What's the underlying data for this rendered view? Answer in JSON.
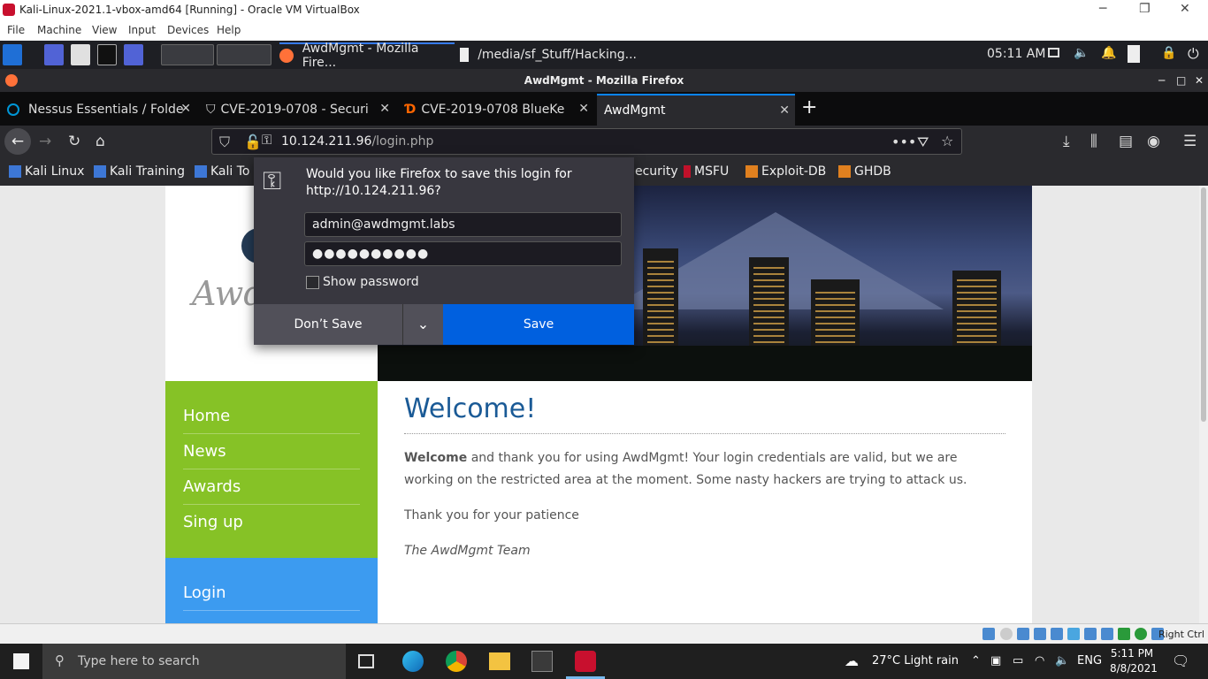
{
  "vbox": {
    "title": "Kali-Linux-2021.1-vbox-amd64 [Running] - Oracle VM VirtualBox",
    "menu": [
      "File",
      "Machine",
      "View",
      "Input",
      "Devices",
      "Help"
    ],
    "status_right": "Right Ctrl"
  },
  "kali_panel": {
    "tasks": [
      {
        "label": "AwdMgmt - Mozilla Fire..."
      },
      {
        "label": "/media/sf_Stuff/Hacking..."
      }
    ],
    "clock": "05:11 AM"
  },
  "firefox": {
    "window_title": "AwdMgmt - Mozilla Firefox",
    "tabs": [
      {
        "label": "Nessus Essentials / Folde"
      },
      {
        "label": "CVE-2019-0708 - Securi"
      },
      {
        "label": "CVE-2019-0708 BlueKe"
      },
      {
        "label": "AwdMgmt"
      }
    ],
    "new_tab": "+",
    "url_host": "10.124.211.96",
    "url_path": "/login.php",
    "url_more": "•••",
    "bookmarks": [
      {
        "label": "Kali Linux"
      },
      {
        "label": "Kali Training"
      },
      {
        "label": "Kali To"
      },
      {
        "label": "ecurity"
      },
      {
        "label": "MSFU"
      },
      {
        "label": "Exploit-DB"
      },
      {
        "label": "GHDB"
      }
    ]
  },
  "popup": {
    "question_line1": "Would you like Firefox to save this login for",
    "question_line2": "http://10.124.211.96?",
    "username": "admin@awdmgmt.labs",
    "password_mask": "●●●●●●●●●●",
    "show_password": "Show password",
    "dont_save": "Don’t Save",
    "save": "Save"
  },
  "site": {
    "logo_text": "Awd",
    "nav": [
      "Home",
      "News",
      "Awards",
      "Sing up"
    ],
    "login": "Login",
    "heading": "Welcome!",
    "para1_bold": "Welcome",
    "para1_rest": " and thank you for using AwdMgmt! Your login credentials are valid, but we are working on the restricted area at the moment. Some nasty hackers are trying to attack us.",
    "para2": "Thank you for your patience",
    "signature": "The AwdMgmt Team"
  },
  "windows": {
    "search_placeholder": "Type here to search",
    "weather": "27°C  Light rain",
    "lang": "ENG",
    "time": "5:11 PM",
    "date": "8/8/2021"
  },
  "colors": {
    "accent": "#0a84ff",
    "sidebar_green": "#86c226",
    "login_blue": "#3c9bf0",
    "save_blue": "#0060df",
    "heading_blue": "#1a5a96"
  }
}
